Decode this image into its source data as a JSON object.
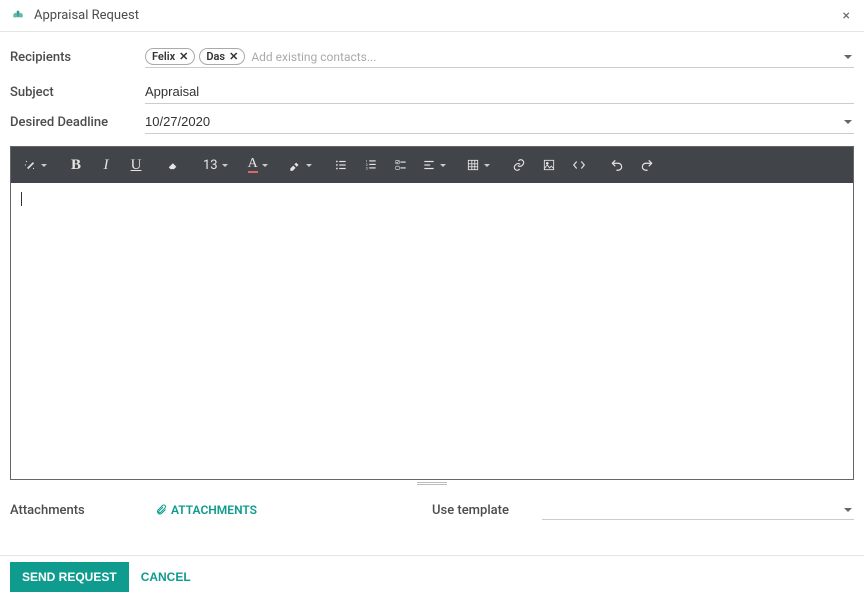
{
  "header": {
    "title": "Appraisal Request"
  },
  "fields": {
    "recipients_label": "Recipients",
    "recipients_placeholder": "Add existing contacts...",
    "recipients_tags": [
      "Felix",
      "Das"
    ],
    "subject_label": "Subject",
    "subject_value": "Appraisal",
    "deadline_label": "Desired Deadline",
    "deadline_value": "10/27/2020"
  },
  "toolbar": {
    "font_size": "13"
  },
  "attachments": {
    "label": "Attachments",
    "link_text": "ATTACHMENTS"
  },
  "template": {
    "label": "Use template"
  },
  "footer": {
    "send": "SEND REQUEST",
    "cancel": "CANCEL"
  }
}
